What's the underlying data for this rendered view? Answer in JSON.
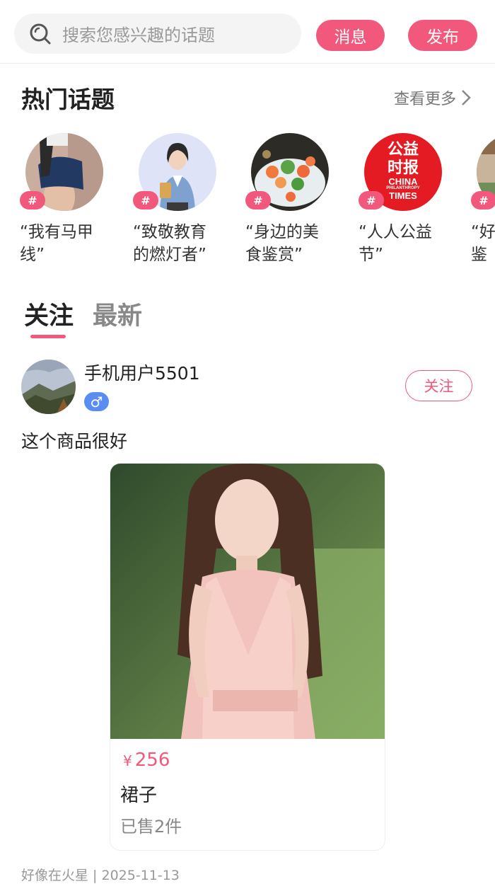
{
  "search": {
    "placeholder": "搜索您感兴趣的话题"
  },
  "header": {
    "messages_label": "消息",
    "publish_label": "发布"
  },
  "hot_topics": {
    "title": "热门话题",
    "more_label": "查看更多",
    "tag_symbol": "#",
    "items": [
      {
        "label": "“我有马甲线”"
      },
      {
        "label": "“致敬教育的燃灯者”"
      },
      {
        "label": "“身边的美食鉴赏”"
      },
      {
        "label": "“人人公益节”"
      },
      {
        "label": "“好图鉴"
      }
    ],
    "logo_text": {
      "line1": "公益",
      "line2": "时报",
      "en1": "CHINA",
      "en2": "PHILANTHROPY",
      "en3": "TIMES"
    }
  },
  "tabs": {
    "follow": "关注",
    "latest": "最新"
  },
  "post": {
    "username": "手机用户5501",
    "gender_symbol": "♂",
    "follow_label": "关注",
    "text": "这个商品很好",
    "product": {
      "currency": "¥",
      "price": "256",
      "name": "裙子",
      "sold": "已售2件"
    },
    "meta": "好像在火星 | 2025-11-13"
  },
  "colors": {
    "accent": "#f2587c",
    "gender_badge": "#5a8df2"
  }
}
